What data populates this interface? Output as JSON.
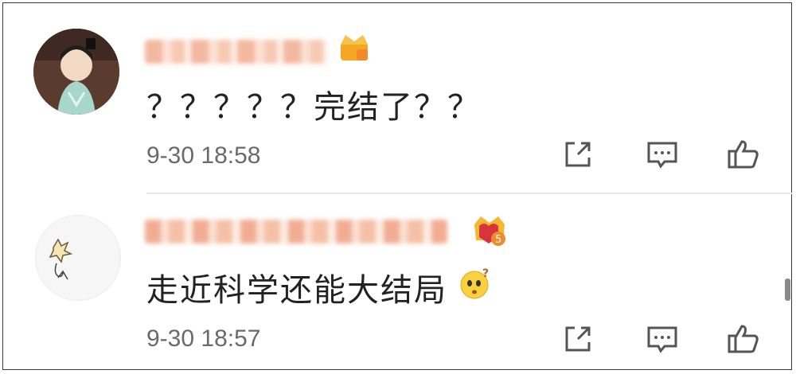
{
  "comments": [
    {
      "content": "？？？？？完结了？？",
      "time": "9-30 18:58",
      "badge_icon": "vip-crown-badge-icon"
    },
    {
      "content": "走近科学还能大结局",
      "time": "9-30 18:57",
      "badge_icon": "vip-crown-badge-icon",
      "emoji_icon": "confused-face-emoji-icon"
    }
  ],
  "actions": [
    "share-icon",
    "comment-icon",
    "like-icon"
  ],
  "colors": {
    "time": "#6a6a6a",
    "icon": "#555555",
    "crown": "#f5a623"
  }
}
